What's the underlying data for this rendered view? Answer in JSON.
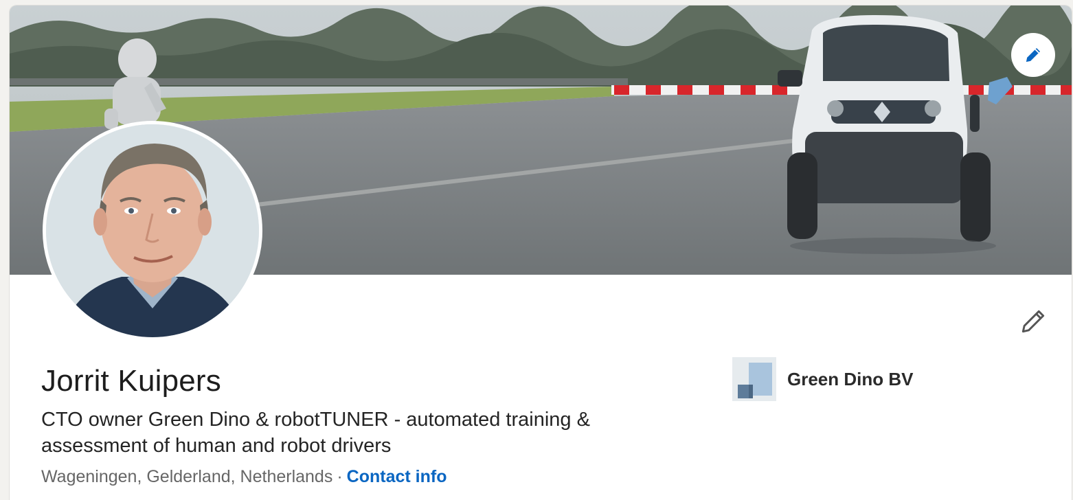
{
  "profile": {
    "name": "Jorrit Kuipers",
    "headline": "CTO owner Green Dino & robotTUNER - automated training & assessment of human and robot drivers",
    "location": "Wageningen, Gelderland, Netherlands",
    "separator": "·",
    "contact_link": "Contact info"
  },
  "company": {
    "name": "Green Dino BV",
    "logo_icon": "company-logo"
  },
  "icons": {
    "banner_edit": "pencil-icon",
    "intro_edit": "pencil-icon"
  },
  "colors": {
    "link": "#0a66c2",
    "edit_icon_blue": "#0a66c2",
    "background": "#f3f2ef"
  }
}
